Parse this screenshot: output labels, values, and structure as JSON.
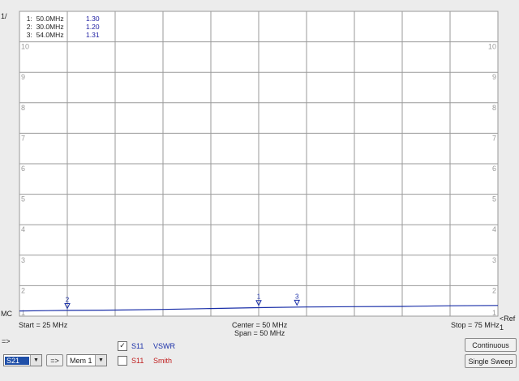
{
  "chart_data": {
    "type": "line",
    "title": "",
    "y_axis_label": "1/",
    "ymin_label": "MC",
    "ref_label": "Ref",
    "ref_value": "1",
    "ylim": [
      1,
      11
    ],
    "yticks": [
      "1",
      "2",
      "3",
      "4",
      "5",
      "6",
      "7",
      "8",
      "9",
      "10"
    ],
    "xlim_mhz": [
      25,
      75
    ],
    "start_label": "Start = 25 MHz",
    "center_label": "Center = 50 MHz",
    "span_label": "Span = 50 MHz",
    "stop_label": "Stop = 75 MHz",
    "grid": true,
    "series": [
      {
        "color": "#1a2fa8",
        "x": [
          25,
          28,
          30,
          35,
          40,
          45,
          50,
          55,
          60,
          65,
          70,
          75
        ],
        "y": [
          1.17,
          1.18,
          1.19,
          1.2,
          1.22,
          1.25,
          1.28,
          1.3,
          1.31,
          1.32,
          1.34,
          1.35
        ]
      }
    ],
    "markers": [
      {
        "id": "1",
        "freq": "50.0MHz",
        "value": "1.30",
        "x": 50,
        "y": 1.3
      },
      {
        "id": "2",
        "freq": "30.0MHz",
        "value": "1.20",
        "x": 30,
        "y": 1.2
      },
      {
        "id": "3",
        "freq": "54.0MHz",
        "value": "1.31",
        "x": 54,
        "y": 1.31
      }
    ]
  },
  "controls": {
    "arrow_label": "=>",
    "param_select": "S21",
    "transfer_button": "=>",
    "memory_select": "Mem 1",
    "trace1": {
      "checked": true,
      "param": "S11",
      "format": "VSWR",
      "color": "#1a2fa8"
    },
    "trace2": {
      "checked": false,
      "param": "S11",
      "format": "Smith",
      "color": "#c02020"
    },
    "continuous_button": "Continuous",
    "single_sweep_button": "Single Sweep"
  }
}
